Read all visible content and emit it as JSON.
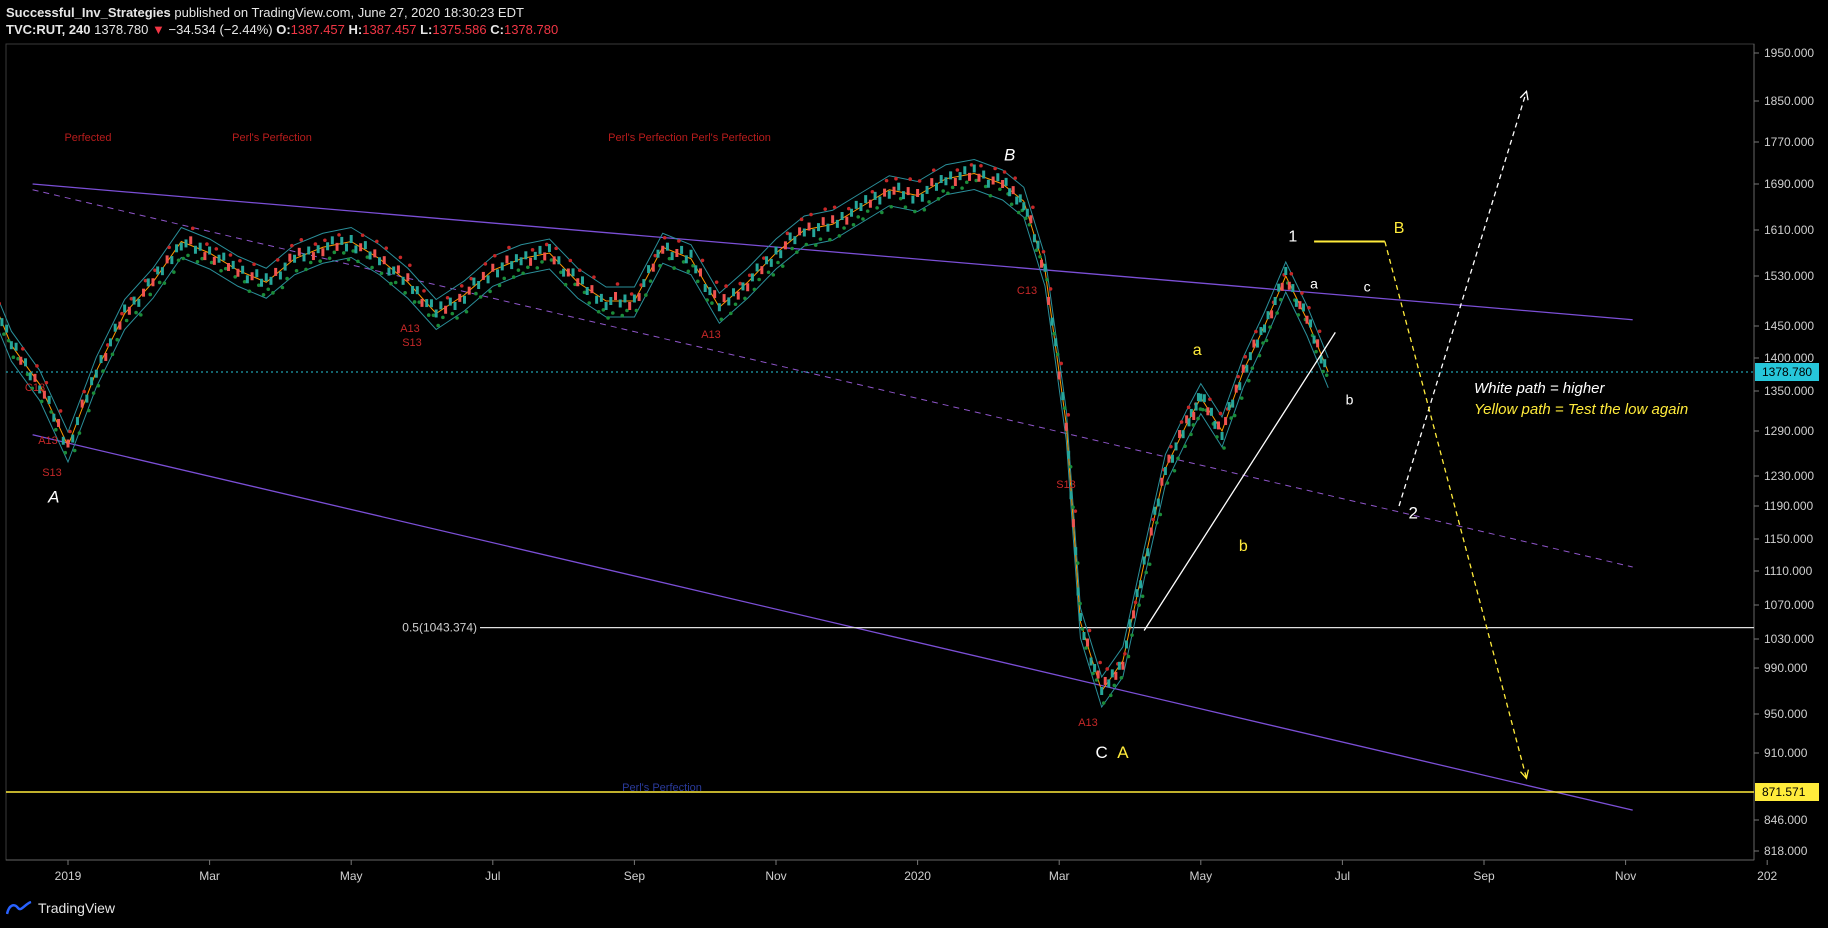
{
  "header": {
    "author": "Successful_Inv_Strategies",
    "published": "published on TradingView.com, June 27, 2020 18:30:23 EDT",
    "symbol": "TVC:RUT, 240",
    "last": "1378.780",
    "arrow": "▼",
    "change": "−34.534 (−2.44%)",
    "o_label": "O:",
    "o": "1387.457",
    "h_label": "H:",
    "h": "1387.457",
    "l_label": "L:",
    "l": "1375.586",
    "c_label": "C:",
    "c": "1378.780"
  },
  "footer": {
    "brand": "TradingView"
  },
  "colors": {
    "up": "#26a69a",
    "down": "#ef5350",
    "channel": "#7b4fd6",
    "yellow": "#ffeb3b",
    "bg": "#000000"
  },
  "chart_data": {
    "type": "line",
    "x_ticks": [
      "2019",
      "Mar",
      "May",
      "Jul",
      "Sep",
      "Nov",
      "2020",
      "Mar",
      "May",
      "Jul",
      "Sep",
      "Nov",
      "202"
    ],
    "x_tick_index": [
      0,
      2,
      4,
      6,
      8,
      10,
      12,
      14,
      16,
      18,
      20,
      22,
      24
    ],
    "y_ticks": [
      818,
      846,
      871.571,
      910,
      950,
      990,
      1030,
      1070,
      1110,
      1150,
      1190,
      1230,
      1290,
      1350,
      1400,
      1450,
      1530,
      1610,
      1690,
      1770,
      1850,
      1950
    ],
    "y_tick_labels": [
      "818.000",
      "846.000",
      "",
      "910.000",
      "950.000",
      "990.000",
      "1030.000",
      "1070.000",
      "1110.000",
      "1150.000",
      "1190.000",
      "1230.000",
      "1290.000",
      "1350.000",
      "1400.000",
      "1450.000",
      "1530.000",
      "1610.000",
      "1690.000",
      "1770.000",
      "1850.000",
      "1950.000"
    ],
    "ylim": [
      800,
      1980
    ],
    "price_series": {
      "x": [
        -1.2,
        -0.8,
        -0.4,
        0.0,
        0.4,
        0.8,
        1.2,
        1.6,
        2.0,
        2.4,
        2.8,
        3.2,
        3.6,
        4.0,
        4.4,
        4.8,
        5.2,
        5.6,
        6.0,
        6.4,
        6.8,
        7.2,
        7.6,
        8.0,
        8.4,
        8.8,
        9.2,
        9.6,
        10.0,
        10.4,
        10.8,
        11.2,
        11.6,
        12.0,
        12.4,
        12.8,
        13.2,
        13.5,
        13.8,
        14.1,
        14.3,
        14.6,
        14.9,
        15.2,
        15.5,
        15.8,
        16.0,
        16.3,
        16.6,
        16.9,
        17.2,
        17.5,
        17.8
      ],
      "y": [
        1530,
        1420,
        1360,
        1270,
        1380,
        1470,
        1520,
        1590,
        1570,
        1540,
        1520,
        1560,
        1580,
        1590,
        1560,
        1520,
        1470,
        1500,
        1540,
        1560,
        1570,
        1520,
        1490,
        1490,
        1580,
        1560,
        1480,
        1520,
        1570,
        1610,
        1620,
        1650,
        1680,
        1670,
        1700,
        1710,
        1690,
        1660,
        1540,
        1300,
        1050,
        970,
        1000,
        1120,
        1240,
        1300,
        1340,
        1290,
        1380,
        1450,
        1530,
        1460,
        1379
      ]
    },
    "last_price": 1378.78,
    "last_price_label": "1378.780",
    "support_price": 871.571,
    "support_label": "871.571",
    "fib_level": 1043.374,
    "fib_label": "0.5(1043.374)",
    "channel_upper": [
      [
        -0.5,
        1690
      ],
      [
        22.1,
        1460
      ]
    ],
    "channel_lower": [
      [
        -0.5,
        1285
      ],
      [
        22.1,
        855
      ]
    ],
    "channel_mid": [
      [
        -0.5,
        1680
      ],
      [
        22.1,
        1115
      ]
    ],
    "trendline": [
      [
        15.2,
        1040
      ],
      [
        17.9,
        1440
      ]
    ],
    "yellow_level": [
      [
        17.6,
        1590
      ],
      [
        18.6,
        1590
      ]
    ],
    "white_path": [
      [
        18.8,
        1190
      ],
      [
        20.6,
        1870
      ]
    ],
    "yellow_path": [
      [
        18.6,
        1590
      ],
      [
        20.6,
        885
      ]
    ],
    "annotations": [
      {
        "text": "A",
        "x": -0.2,
        "y": 1195,
        "color": "#ffffff",
        "italic": true,
        "size": 17
      },
      {
        "text": "B",
        "x": 13.3,
        "y": 1735,
        "color": "#ffffff",
        "italic": true,
        "size": 17
      },
      {
        "text": "C",
        "x": 14.6,
        "y": 905,
        "color": "#ffffff",
        "italic": false,
        "size": 17
      },
      {
        "text": "A",
        "x": 14.9,
        "y": 905,
        "color": "#ffeb3b",
        "italic": false,
        "size": 17
      },
      {
        "text": "a",
        "x": 15.95,
        "y": 1405,
        "color": "#ffeb3b",
        "italic": false,
        "size": 16
      },
      {
        "text": "b",
        "x": 16.6,
        "y": 1135,
        "color": "#ffeb3b",
        "italic": false,
        "size": 16
      },
      {
        "text": "1",
        "x": 17.3,
        "y": 1590,
        "color": "#ffffff",
        "italic": false,
        "size": 16
      },
      {
        "text": "a",
        "x": 17.6,
        "y": 1510,
        "color": "#ffffff",
        "italic": false,
        "size": 14
      },
      {
        "text": "c",
        "x": 18.35,
        "y": 1505,
        "color": "#ffffff",
        "italic": false,
        "size": 14
      },
      {
        "text": "b",
        "x": 18.1,
        "y": 1330,
        "color": "#ffffff",
        "italic": false,
        "size": 14
      },
      {
        "text": "B",
        "x": 18.8,
        "y": 1605,
        "color": "#ffeb3b",
        "italic": false,
        "size": 16
      },
      {
        "text": "2",
        "x": 19.0,
        "y": 1175,
        "color": "#ffffff",
        "italic": false,
        "size": 17
      }
    ],
    "legend_notes": [
      {
        "text": "White path = higher",
        "color": "#ffffff"
      },
      {
        "text": "Yellow path = Test the low again",
        "color": "#ffeb3b"
      }
    ],
    "perl_labels": [
      "Perfected",
      "Perl's Perfection",
      "Perl's Perfection",
      "Perl's Perfection",
      "Perl's Perfection"
    ],
    "td_labels": [
      "A13",
      "S13",
      "C13",
      "A13",
      "S13",
      "A13",
      "S13",
      "A13",
      "C13"
    ]
  }
}
